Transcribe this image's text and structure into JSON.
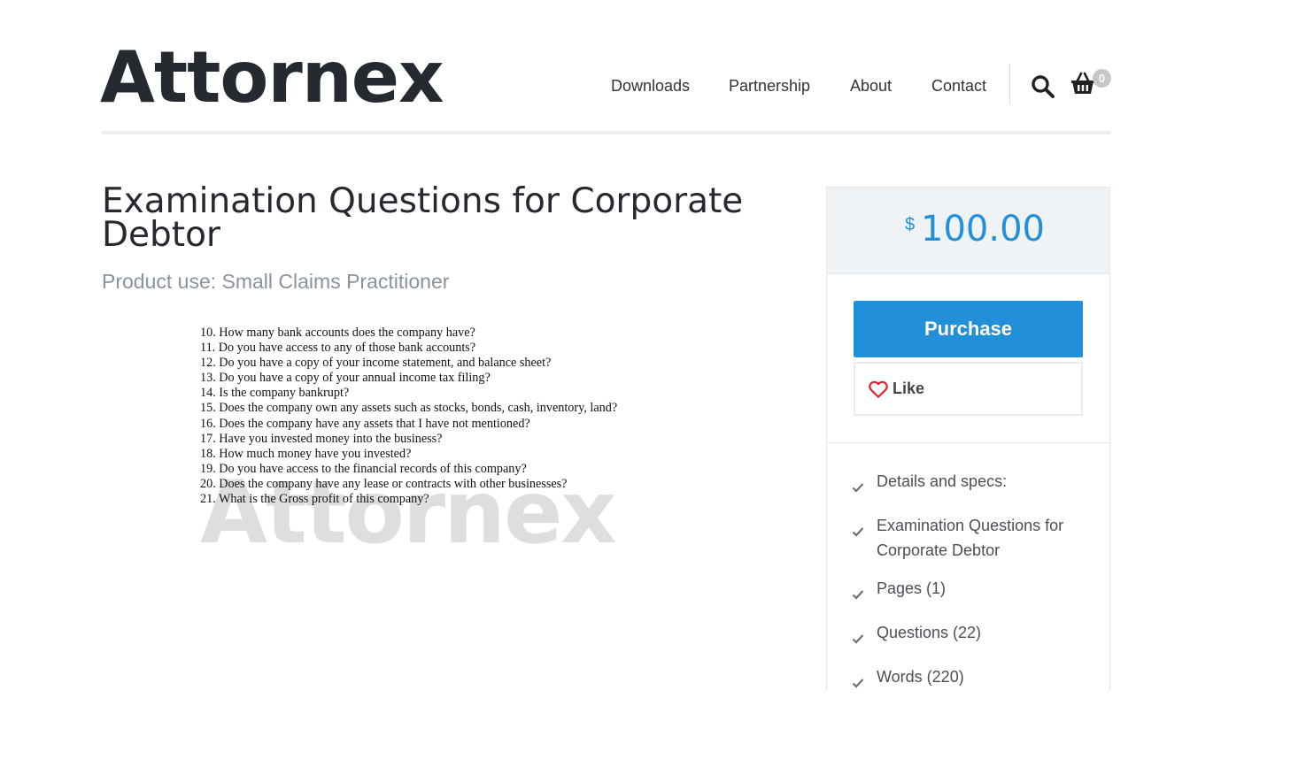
{
  "site": {
    "logo": "Attornex"
  },
  "nav": {
    "items": [
      "Downloads",
      "Partnership",
      "About",
      "Contact"
    ],
    "cart_count": "0"
  },
  "product": {
    "title": "Examination Questions for Corporate Debtor",
    "product_use": "Product use: Small Claims Practitioner",
    "preview_watermark": "Attornex",
    "preview_questions": [
      "10. How many bank accounts does the company have?",
      "11. Do you have access to any of those bank accounts?",
      "12. Do you have a copy of your income statement, and balance sheet?",
      "13. Do you have a copy of your annual income tax filing?",
      "14. Is the company bankrupt?",
      "15. Does the company own any assets such as stocks, bonds, cash, inventory, land?",
      "16. Does the company have any assets that I have not mentioned?",
      "17. Have you invested money into the business?",
      "18. How much money have you invested?",
      "19. Do you have access to the financial records of this company?",
      "20. Does the company have any lease or contracts with other businesses?",
      "21. What is the Gross profit of this company?"
    ]
  },
  "sidebar": {
    "currency": "$",
    "price": "100.00",
    "purchase_label": "Purchase",
    "like_label": "Like",
    "specs": [
      "Details and specs:",
      "Examination Questions for Corporate Debtor",
      "Pages (1)",
      "Questions (22)",
      "Words (220)"
    ]
  },
  "colors": {
    "accent": "#2290d8",
    "heart": "#e0202e",
    "text_dark": "#252a30",
    "muted": "#8a939c"
  }
}
